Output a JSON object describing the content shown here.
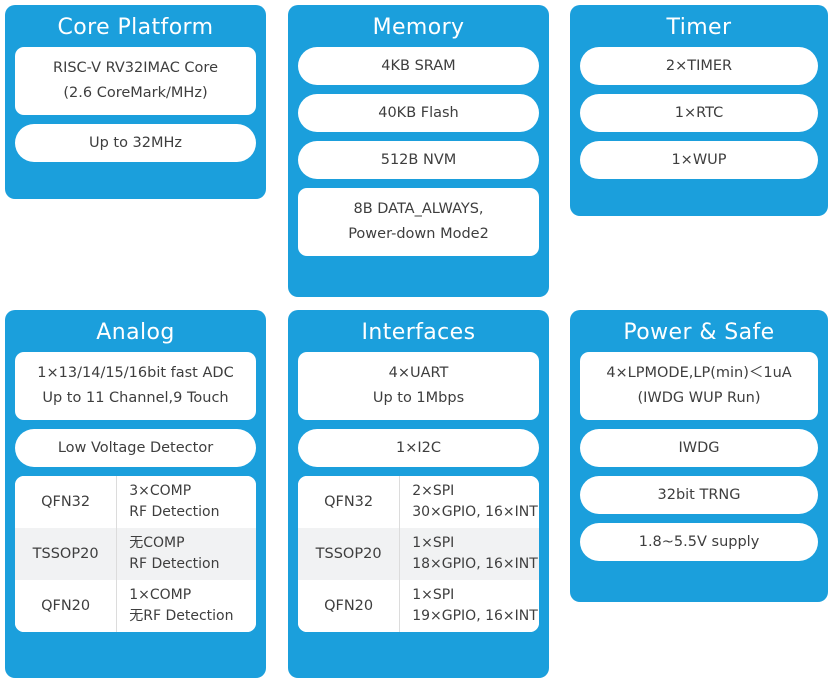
{
  "theme": {
    "card_blue": "#1b9fdc",
    "pill_white": "#ffffff",
    "text_dark": "#3e3e3e",
    "title_white": "#ffffff",
    "row_alt_gray": "#f1f2f3"
  },
  "cards": {
    "core": {
      "title": "Core Platform",
      "items": [
        {
          "lines": [
            "RISC-V RV32IMAC Core",
            "(2.6 CoreMark/MHz)"
          ]
        },
        {
          "lines": [
            "Up to 32MHz"
          ]
        }
      ]
    },
    "memory": {
      "title": "Memory",
      "items": [
        {
          "lines": [
            "4KB SRAM"
          ]
        },
        {
          "lines": [
            "40KB Flash"
          ]
        },
        {
          "lines": [
            "512B NVM"
          ]
        },
        {
          "lines": [
            "8B DATA_ALWAYS,",
            "Power-down Mode2"
          ]
        }
      ]
    },
    "timer": {
      "title": "Timer",
      "items": [
        {
          "lines": [
            "2×TIMER"
          ]
        },
        {
          "lines": [
            "1×RTC"
          ]
        },
        {
          "lines": [
            "1×WUP"
          ]
        }
      ]
    },
    "analog": {
      "title": "Analog",
      "items": [
        {
          "lines": [
            "1×13/14/15/16bit  fast ADC",
            "Up to 11 Channel,9 Touch"
          ]
        },
        {
          "lines": [
            "Low Voltage Detector"
          ]
        }
      ],
      "table": {
        "rows": [
          {
            "package": "QFN32",
            "lines": [
              "3×COMP",
              "RF Detection"
            ]
          },
          {
            "package": "TSSOP20",
            "lines": [
              "无COMP",
              "RF Detection"
            ]
          },
          {
            "package": "QFN20",
            "lines": [
              "1×COMP",
              "无RF Detection"
            ]
          }
        ]
      }
    },
    "interfaces": {
      "title": "Interfaces",
      "items": [
        {
          "lines": [
            "4×UART",
            "Up to 1Mbps"
          ]
        },
        {
          "lines": [
            "1×I2C"
          ]
        }
      ],
      "table": {
        "rows": [
          {
            "package": "QFN32",
            "lines": [
              "2×SPI",
              "30×GPIO, 16×INT"
            ]
          },
          {
            "package": "TSSOP20",
            "lines": [
              "1×SPI",
              "18×GPIO, 16×INT"
            ]
          },
          {
            "package": "QFN20",
            "lines": [
              "1×SPI",
              "19×GPIO, 16×INT"
            ]
          }
        ]
      }
    },
    "power": {
      "title": "Power & Safe",
      "items": [
        {
          "lines": [
            "4×LPMODE,LP(min)＜1uA",
            "(IWDG  WUP Run)"
          ]
        },
        {
          "lines": [
            "IWDG"
          ]
        },
        {
          "lines": [
            "32bit TRNG"
          ]
        },
        {
          "lines": [
            "1.8~5.5V supply"
          ]
        }
      ]
    }
  }
}
